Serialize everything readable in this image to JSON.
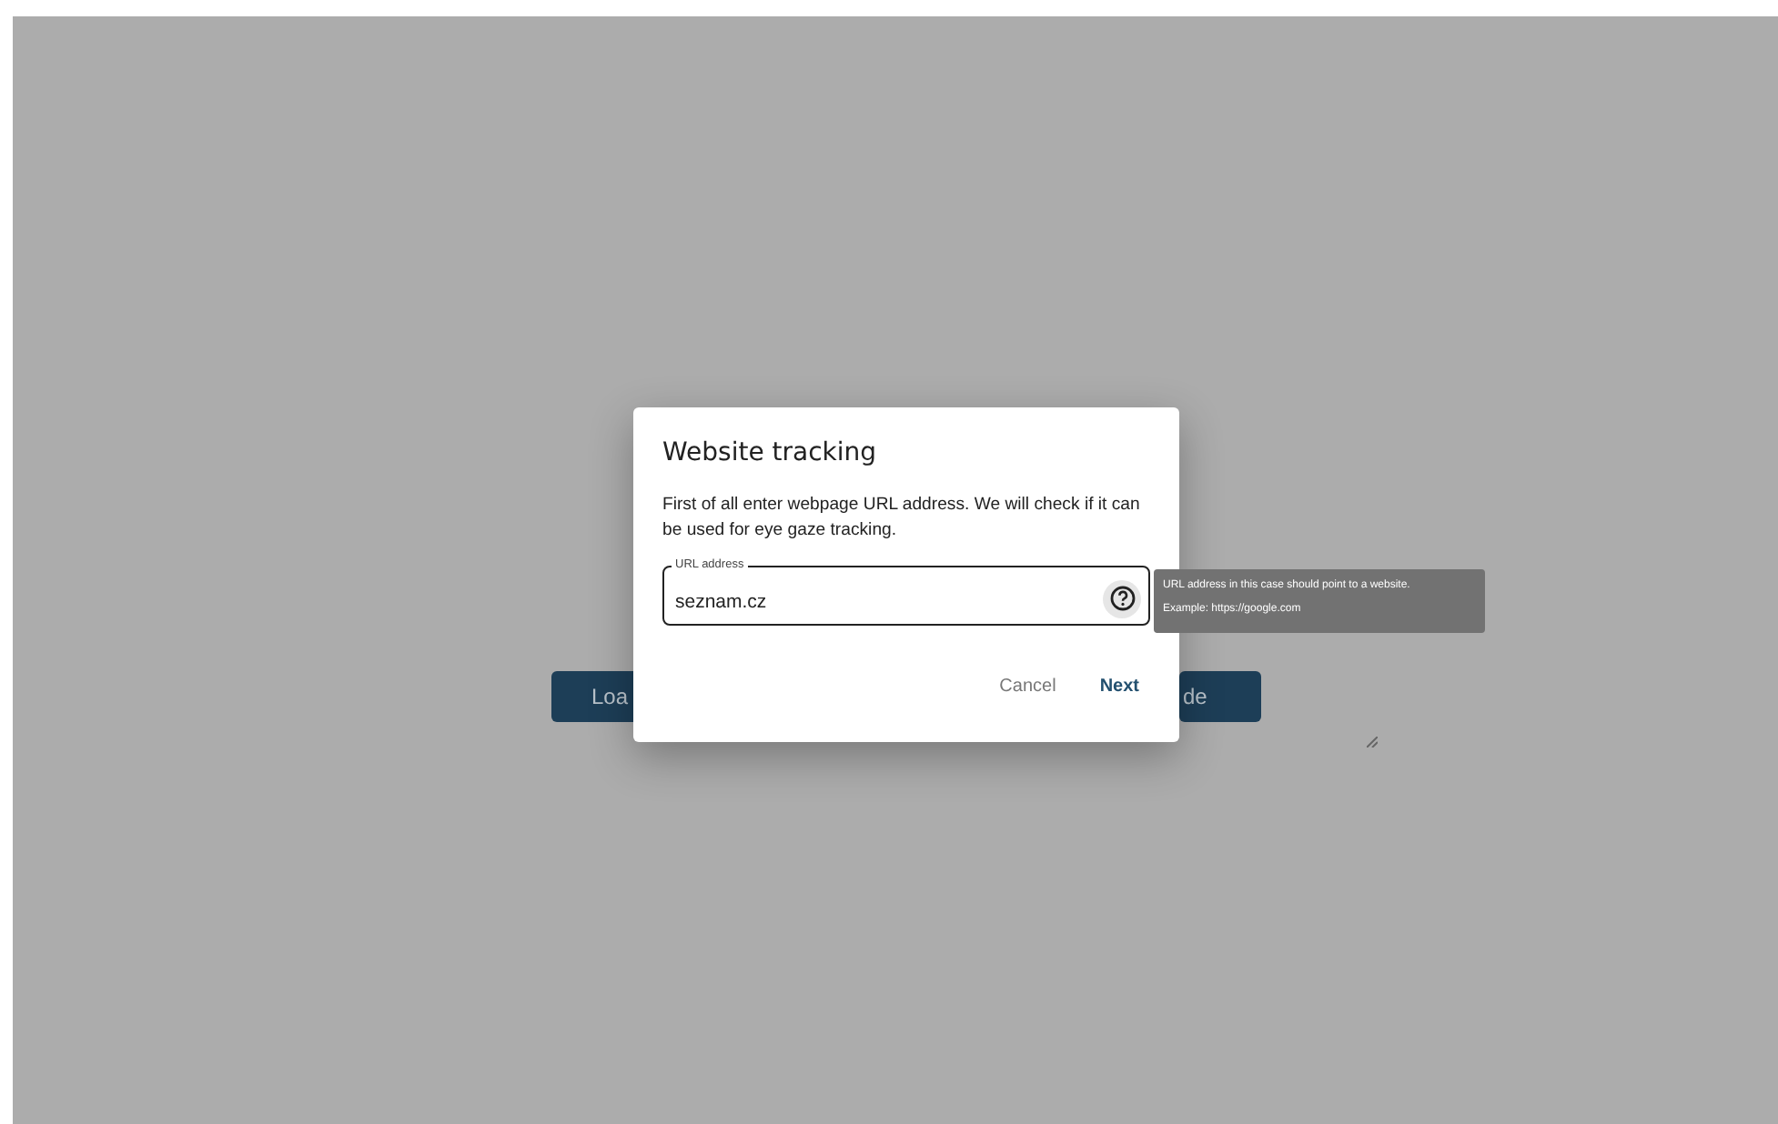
{
  "background_buttons": [
    {
      "label": "Loa"
    },
    {
      "label": "de"
    }
  ],
  "dialog": {
    "title": "Website tracking",
    "text": "First of all enter webpage URL address. We will check if it can be used for eye gaze tracking.",
    "field": {
      "label": "URL address",
      "value": "seznam.cz"
    },
    "tooltip": {
      "lines": [
        "URL address in this case should point to a website.",
        "Example: https://google.com"
      ]
    },
    "buttons": [
      {
        "label": "Cancel",
        "kind": "secondary"
      },
      {
        "label": "Next",
        "kind": "primary"
      }
    ]
  }
}
